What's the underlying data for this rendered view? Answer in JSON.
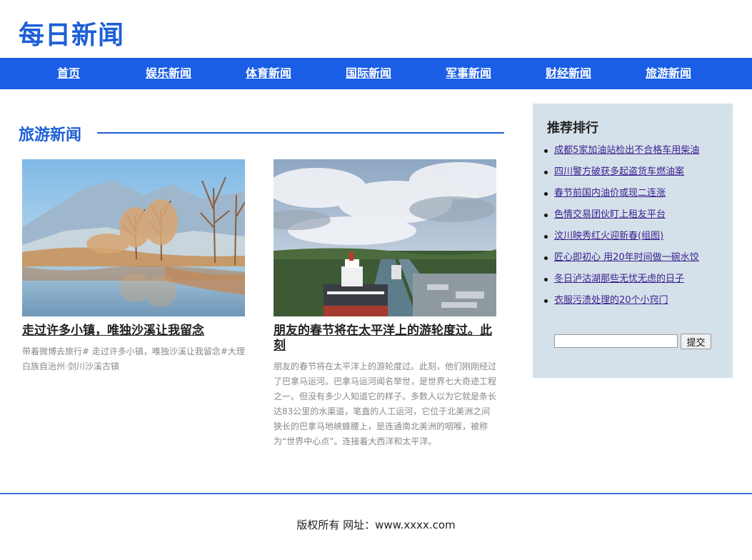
{
  "site": {
    "title": "每日新闻"
  },
  "nav": [
    "首页",
    "娱乐新闻",
    "体育新闻",
    "国际新闻",
    "军事新闻",
    "财经新闻",
    "旅游新闻"
  ],
  "section": {
    "title": "旅游新闻"
  },
  "articles": [
    {
      "title": "走过许多小镇，唯独沙溪让我留念",
      "desc": "带着微博去旅行# 走过许多小镇，唯独沙溪让我留念#大理白族自治州·剑川沙溪古镇",
      "image_icon": "lake-mountain-image"
    },
    {
      "title": "朋友的春节将在太平洋上的游轮度过。此刻",
      "desc": "朋友的春节将在太平洋上的游轮度过。此刻，他们刚刚经过了巴拿马运河。巴拿马运河闻名举世，是世界七大奇迹工程之一。但没有多少人知道它的样子。多数人以为它就是条长达83公里的水渠道，笔直的人工运河，它位于北美洲之间狭长的巴拿马地峡蜂腰上，是连通南北美洲的咽喉，被称为“世界中心点”。连接着大西洋和太平洋。",
      "image_icon": "canal-ship-image"
    }
  ],
  "sidebar": {
    "title": "推荐排行",
    "items": [
      "成都5家加油站检出不合格车用柴油",
      "四川警方破获多起盗货车燃油案",
      "春节前国内油价或现二连涨",
      "色情交易团伙盯上租友平台",
      "汶川映秀红火迎新春(组图)",
      "匠心即初心 用20年时间做一碗水饺",
      "冬日泸沽湖那些无忧无虑的日子",
      "衣服污渍处理的20个小窍门"
    ],
    "search_value": "",
    "submit_label": "提交"
  },
  "footer": {
    "text": "版权所有 网址：www.xxxx.com"
  },
  "colors": {
    "brand": "#1e5fd6",
    "nav_bg": "#1a5ee6",
    "sidebar_bg": "#d5e1ea",
    "link": "#3a1f8f"
  }
}
